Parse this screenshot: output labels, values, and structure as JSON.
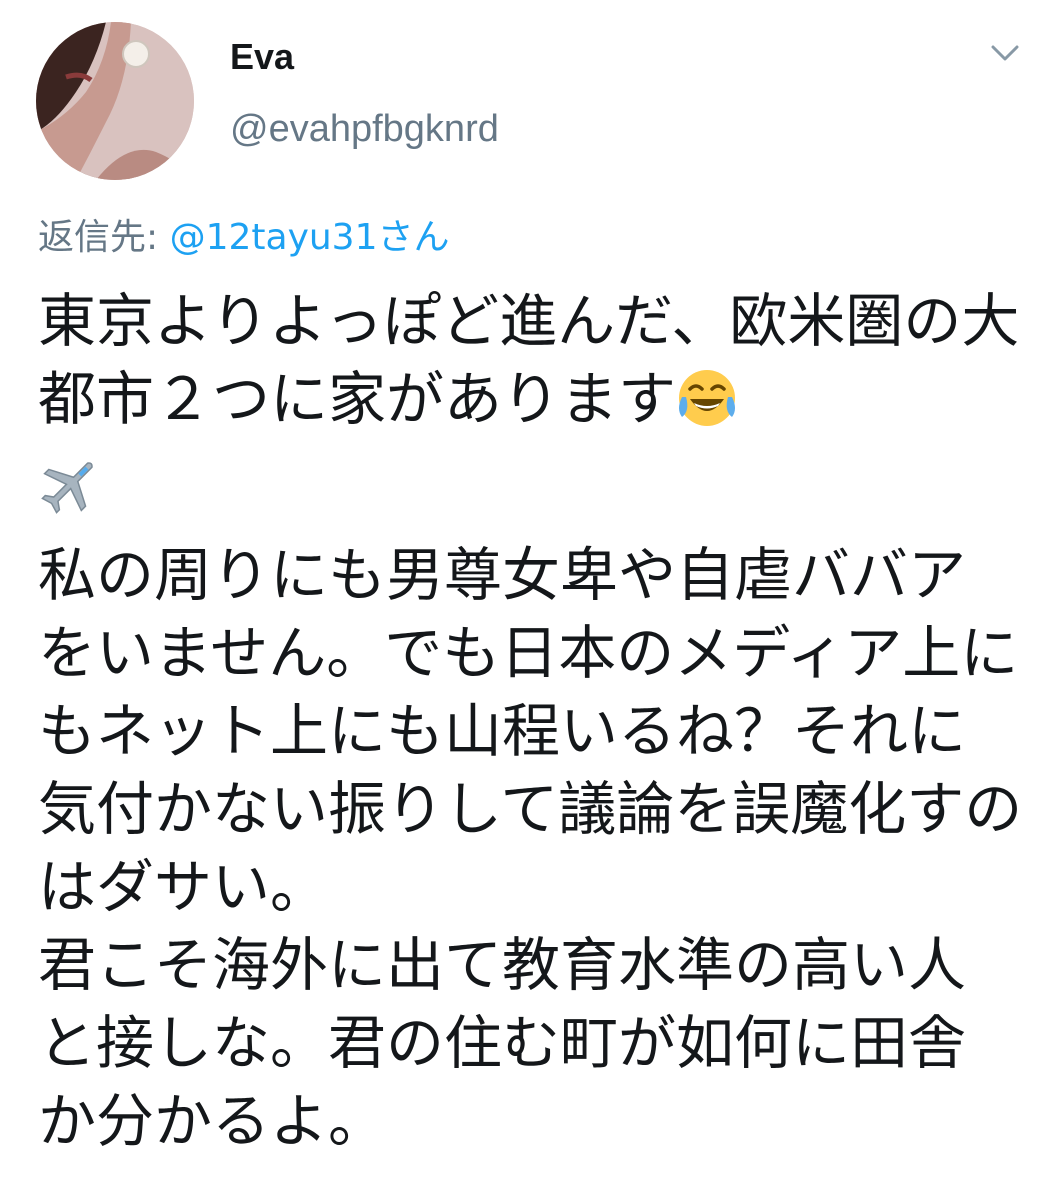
{
  "user": {
    "display_name": "Eva",
    "handle": "@evahpfbgknrd"
  },
  "reply": {
    "prefix": "返信先: ",
    "mention": "@12tayu31さん"
  },
  "tweet": {
    "line1": "東京よりよっぽど進んだ、欧米圏の大都市２つに家があります",
    "line2": "私の周りにも男尊女卑や自虐ババアをいません。でも日本のメディア上にもネット上にも山程いるね？それに気付かない振りして議論を誤魔化すのはダサい。\n君こそ海外に出て教育水準の高い人と接しな。君の住む町が如何に田舎か分かるよ。"
  },
  "icons": {
    "caret": "chevron-down-icon",
    "emoji_1": "tears-of-joy-emoji",
    "emoji_2": "airplane-emoji"
  }
}
